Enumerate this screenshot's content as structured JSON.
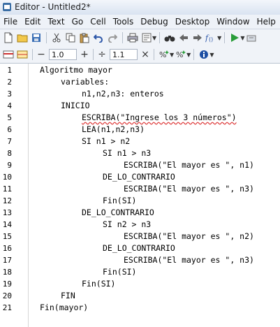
{
  "window": {
    "title": "Editor - Untitled2*"
  },
  "menu": [
    "File",
    "Edit",
    "Text",
    "Go",
    "Cell",
    "Tools",
    "Debug",
    "Desktop",
    "Window",
    "Help"
  ],
  "toolbar": {
    "cell_step_1": "1.0",
    "cell_step_2": "1.1",
    "minus_label": "−",
    "plus_label": "+",
    "divide_label": "÷",
    "times_label": "×"
  },
  "editor": {
    "line_numbers": [
      "1",
      "2",
      "3",
      "4",
      "5",
      "6",
      "7",
      "8",
      "9",
      "10",
      "11",
      "12",
      "13",
      "14",
      "15",
      "16",
      "17",
      "18",
      "19",
      "20",
      "21"
    ],
    "lines": [
      "Algoritmo mayor",
      "variables:",
      "n1,n2,n3: enteros",
      "INICIO",
      "ESCRIBA(\"Ingrese los 3 números\")",
      "LEA(n1,n2,n3)",
      "SI n1 > n2",
      "SI n1 > n3",
      "ESCRIBA(\"El mayor es \", n1)",
      "DE_LO_CONTRARIO",
      "ESCRIBA(\"El mayor es \", n3)",
      "Fin(SI)",
      "DE_LO_CONTRARIO",
      "SI n2 > n3",
      "ESCRIBA(\"El mayor es \", n2)",
      "DE_LO_CONTRARIO",
      "ESCRIBA(\"El mayor es \", n3)",
      "Fin(SI)",
      "Fin(SI)",
      "FIN",
      "Fin(mayor)"
    ]
  },
  "colors": {
    "keyword": "#000000",
    "string": "#a020f0",
    "identifier": "#7d1aa0",
    "squiggle": "#dd3333"
  }
}
